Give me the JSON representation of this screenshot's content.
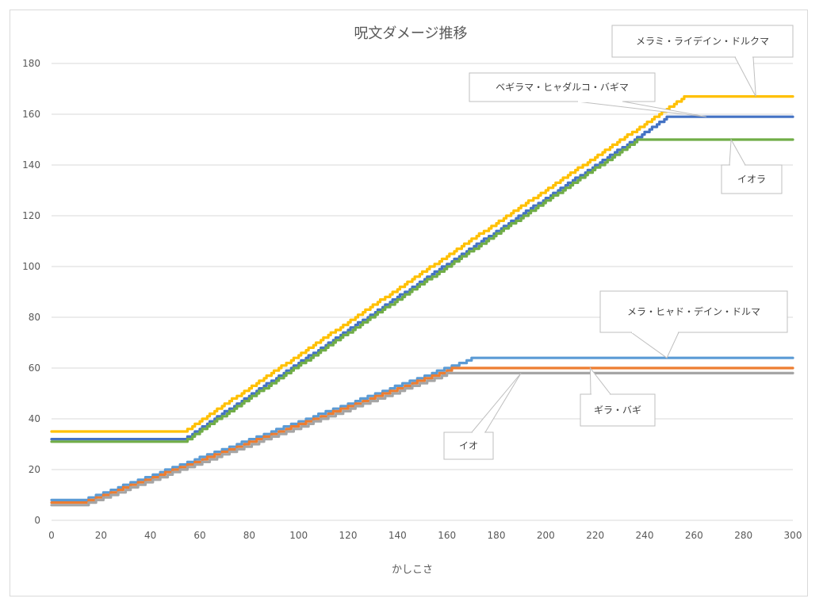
{
  "chart_data": {
    "type": "line",
    "title": "呪文ダメージ推移",
    "xlabel": "かしこさ",
    "ylabel": "",
    "xlim": [
      0,
      300
    ],
    "ylim": [
      0,
      180
    ],
    "x_ticks": [
      0,
      20,
      40,
      60,
      80,
      100,
      120,
      140,
      160,
      180,
      200,
      220,
      240,
      260,
      280,
      300
    ],
    "y_ticks": [
      0,
      20,
      40,
      60,
      80,
      100,
      120,
      140,
      160,
      180
    ],
    "grid": true,
    "legend": "none (data callouts)",
    "series": [
      {
        "name": "メラミ・ライデイン・ドルクマ",
        "color": "#ffc000",
        "step_model": "flat then linear rise (stepped) then flat",
        "points": [
          [
            0,
            35
          ],
          [
            53,
            35
          ],
          [
            256,
            167
          ],
          [
            300,
            167
          ]
        ],
        "callout_anchor_x": 285
      },
      {
        "name": "ベギラマ・ヒャダルコ・バギマ",
        "color": "#4472c4",
        "points": [
          [
            0,
            32
          ],
          [
            53,
            32
          ],
          [
            249,
            159
          ],
          [
            300,
            159
          ]
        ],
        "callout_anchor_x": 265
      },
      {
        "name": "イオラ",
        "color": "#70ad47",
        "points": [
          [
            0,
            31
          ],
          [
            53,
            31
          ],
          [
            237,
            150
          ],
          [
            300,
            150
          ]
        ],
        "callout_anchor_x": 275
      },
      {
        "name": "メラ・ヒャド・デイン・ドルマ",
        "color": "#5b9bd5",
        "points": [
          [
            0,
            8
          ],
          [
            12,
            8
          ],
          [
            170,
            64
          ],
          [
            300,
            64
          ]
        ],
        "callout_anchor_x": 249
      },
      {
        "name": "ギラ・バギ",
        "color": "#ed7d31",
        "points": [
          [
            0,
            7
          ],
          [
            12,
            7
          ],
          [
            162,
            60
          ],
          [
            300,
            60
          ]
        ],
        "callout_anchor_x": 218
      },
      {
        "name": "イオ",
        "color": "#a5a5a5",
        "points": [
          [
            0,
            6
          ],
          [
            12,
            6
          ],
          [
            160,
            58
          ],
          [
            300,
            58
          ]
        ],
        "callout_anchor_x": 190
      }
    ]
  },
  "colors": {
    "grid": "#d9d9d9",
    "text": "#595959",
    "callout_border": "#bfbfbf"
  }
}
